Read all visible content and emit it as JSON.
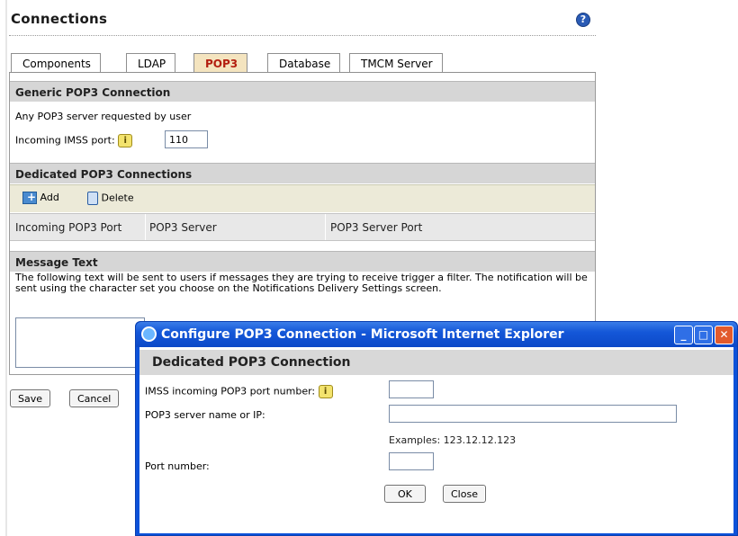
{
  "page": {
    "title": "Connections",
    "help_icon": "question-mark-icon"
  },
  "tabs": [
    {
      "label": "Components",
      "active": false
    },
    {
      "label": "LDAP",
      "active": false
    },
    {
      "label": "POP3",
      "active": true
    },
    {
      "label": "Database",
      "active": false
    },
    {
      "label": "TMCM Server",
      "active": false
    }
  ],
  "generic": {
    "heading": "Generic POP3 Connection",
    "description": "Any POP3 server requested by user",
    "port_label": "Incoming IMSS port:",
    "port_value": "110"
  },
  "dedicated": {
    "heading": "Dedicated POP3 Connections",
    "add_label": "Add",
    "delete_label": "Delete",
    "columns": [
      "Incoming POP3 Port",
      "POP3 Server",
      "POP3 Server Port"
    ]
  },
  "message": {
    "heading": "Message Text",
    "text": "The following text will be sent to users if messages they are trying to receive trigger a filter. The notification will be sent using the character set you choose on the Notifications Delivery Settings screen."
  },
  "actions": {
    "save": "Save",
    "cancel": "Cancel"
  },
  "dialog": {
    "title": "Configure POP3 Connection - Microsoft Internet Explorer",
    "heading": "Dedicated POP3 Connection",
    "imss_port_label": "IMSS incoming POP3 port number:",
    "imss_port_value": "",
    "server_label": "POP3 server name or IP:",
    "server_value": "",
    "example_text": "Examples: 123.12.12.123",
    "port_label": "Port number:",
    "port_value": "",
    "ok": "OK",
    "close": "Close"
  },
  "colors": {
    "active_tab_bg": "#f4e4bf",
    "active_tab_text": "#b31e0f",
    "section_header_bg": "#d6d6d6",
    "toolbar_bg": "#ecead8",
    "xp_title_blue": "#0c52d9"
  }
}
